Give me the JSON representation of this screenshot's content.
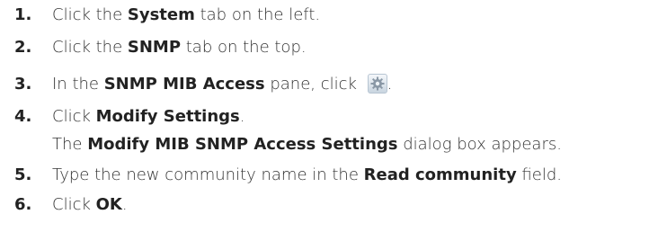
{
  "steps": [
    {
      "num": "1.",
      "pre": "Click the ",
      "bold": "System",
      "post": " tab on the left."
    },
    {
      "num": "2.",
      "pre": "Click the ",
      "bold": "SNMP",
      "post": " tab on the top."
    },
    {
      "num": "3.",
      "pre": "In the ",
      "bold": "SNMP MIB Access",
      "post": " pane, click ",
      "icon": "gear-settings-icon",
      "tail": "."
    },
    {
      "num": "4.",
      "pre": "Click ",
      "bold": "Modify Settings",
      "post": "."
    },
    {
      "pre": "The ",
      "bold": "Modify MIB SNMP Access Settings",
      "post": " dialog box appears."
    },
    {
      "num": "5.",
      "pre": "Type the new community name in the ",
      "bold": "Read community",
      "post": " field."
    },
    {
      "num": "6.",
      "pre": "Click ",
      "bold": "OK",
      "post": "."
    }
  ],
  "colors": {
    "text": "#333333",
    "bold": "#222222",
    "icon_bg": "#d8e1ea"
  }
}
